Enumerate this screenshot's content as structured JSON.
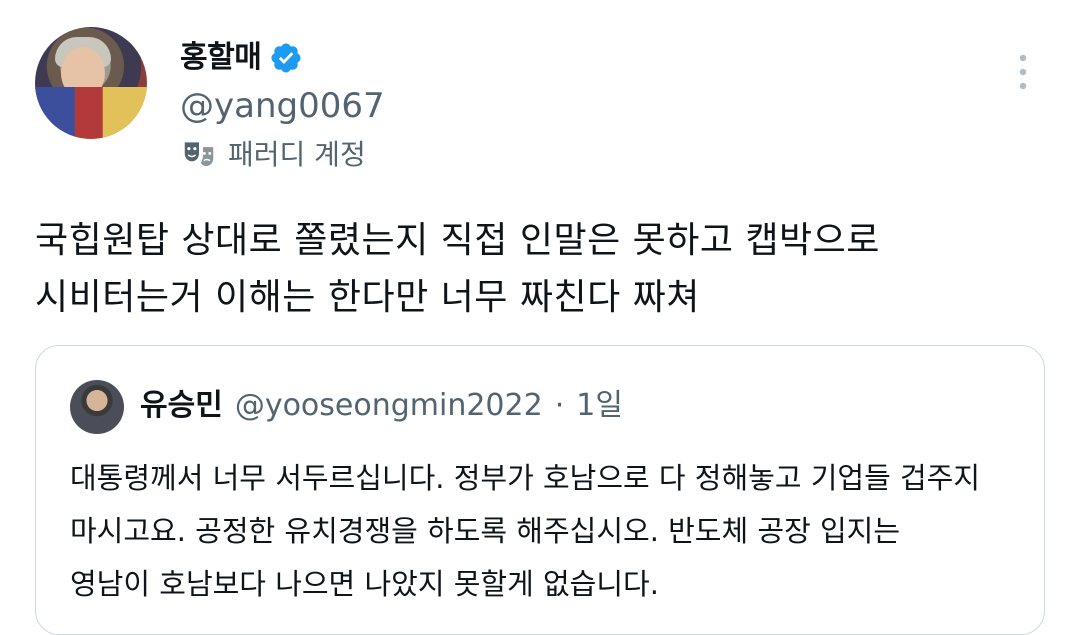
{
  "author": {
    "display_name": "홍할매",
    "handle": "@yang0067",
    "badge": "parody",
    "badge_label": "패러디 계정",
    "verified_color": "#1d9bf0"
  },
  "tweet": {
    "lines": [
      "국힙원탑 상대로 쫄렸는지 직접 인말은 못하고 캡박으로",
      "시비터는거 이해는 한다만 너무 짜친다 짜쳐"
    ]
  },
  "quote": {
    "display_name": "유승민",
    "handle": "@yooseongmin2022",
    "separator": "·",
    "time": "1일",
    "lines": [
      "대통령께서 너무 서두르십니다. 정부가 호남으로 다 정해놓고 기업들 겁주지",
      "마시고요. 공정한 유치경쟁을 하도록 해주십시오. 반도체 공장 입지는",
      "영남이 호남보다 나으면 나았지 못할게 없습니다."
    ]
  },
  "icons": {
    "verified": "verified-badge-icon",
    "parody": "theater-masks-icon",
    "more": "more-vertical-icon"
  }
}
